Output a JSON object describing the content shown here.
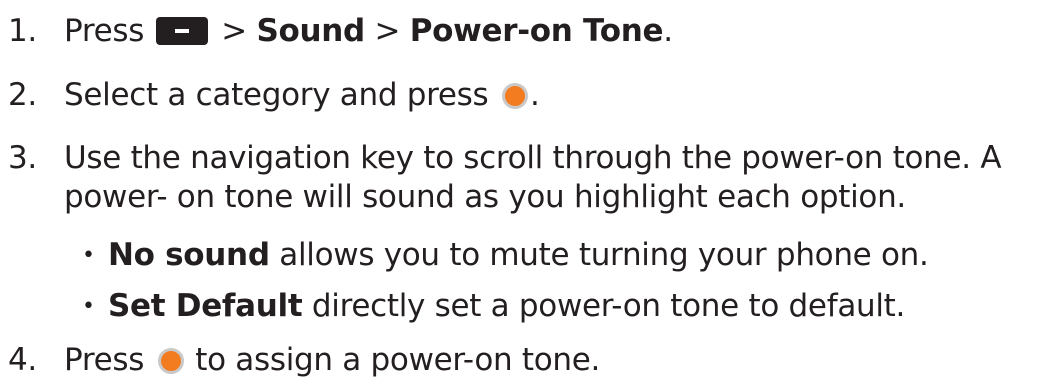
{
  "steps": [
    {
      "number": "1.",
      "press": "Press",
      "sep1": ">",
      "path1": "Sound",
      "sep2": ">",
      "path2": "Power-on Tone",
      "end": "."
    },
    {
      "number": "2.",
      "text": "Select a category and press",
      "end": "."
    },
    {
      "number": "3.",
      "line1": "Use the navigation key to scroll through the power-on tone. A",
      "line2": "power- on tone will sound as you highlight each option.",
      "bullets": [
        {
          "bold": "No sound",
          "text": " allows you to mute turning your phone on."
        },
        {
          "bold": "Set Default",
          "text": " directly set a power-on tone to default."
        }
      ]
    },
    {
      "number": "4.",
      "before": "Press",
      "after": "to assign a power-on tone."
    }
  ],
  "icons": {
    "menu_key": "menu-key-icon",
    "ok_key": "ok-key-icon",
    "accent": "#f47c20",
    "key_dark": "#231f20"
  }
}
